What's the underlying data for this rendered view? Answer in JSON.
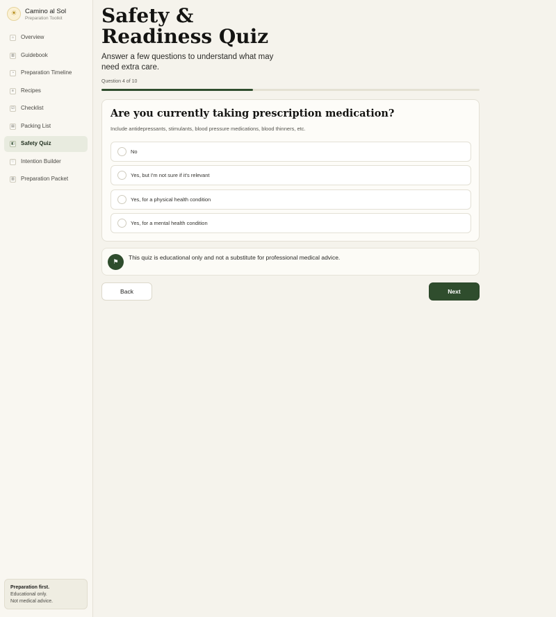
{
  "brand": {
    "title": "Camino al Sol",
    "subtitle": "Preparation Toolkit",
    "logo_icon": "☀"
  },
  "sidebar": {
    "items": [
      {
        "label": "Overview",
        "icon": "⌂",
        "icon_name": "home-icon",
        "active": false
      },
      {
        "label": "Guidebook",
        "icon": "▥",
        "icon_name": "book-icon",
        "active": false
      },
      {
        "label": "Preparation Timeline",
        "icon": "◔",
        "icon_name": "timeline-icon",
        "active": false
      },
      {
        "label": "Recipes",
        "icon": "≡",
        "icon_name": "recipes-icon",
        "active": false
      },
      {
        "label": "Checklist",
        "icon": "☑",
        "icon_name": "checklist-icon",
        "active": false
      },
      {
        "label": "Packing List",
        "icon": "▤",
        "icon_name": "packing-icon",
        "active": false
      },
      {
        "label": "Safety Quiz",
        "icon": "◧",
        "icon_name": "shield-icon",
        "active": true
      },
      {
        "label": "Intention Builder",
        "icon": "♡",
        "icon_name": "heart-icon",
        "active": false
      },
      {
        "label": "Preparation Packet",
        "icon": "▥",
        "icon_name": "packet-icon",
        "active": false
      }
    ],
    "note": {
      "title": "Preparation first.",
      "line1": "Educational only.",
      "line2": "Not medical advice."
    }
  },
  "main": {
    "title": "Safety & Readiness Quiz",
    "subtitle": "Answer a few questions to understand what may need extra care.",
    "progress": {
      "label": "Question 4 of 10",
      "current": 4,
      "total": 10,
      "fraction": 0.4
    },
    "question": {
      "text": "Are you currently taking prescription medication?",
      "hint": "Include antidepressants, stimulants, blood pressure medications, blood thinners, etc.",
      "options": [
        "No",
        "Yes, but I'm not sure if it's relevant",
        "Yes, for a physical health condition",
        "Yes, for a mental health condition"
      ]
    },
    "disclaimer": {
      "text": "This quiz is educational only and not a substitute for professional medical advice.",
      "icon": "⚑"
    },
    "buttons": {
      "back": "Back",
      "next": "Next"
    }
  },
  "colors": {
    "accent": "#2f4d2d",
    "background": "#f5f3ec",
    "sidebar": "#f9f7f1"
  }
}
